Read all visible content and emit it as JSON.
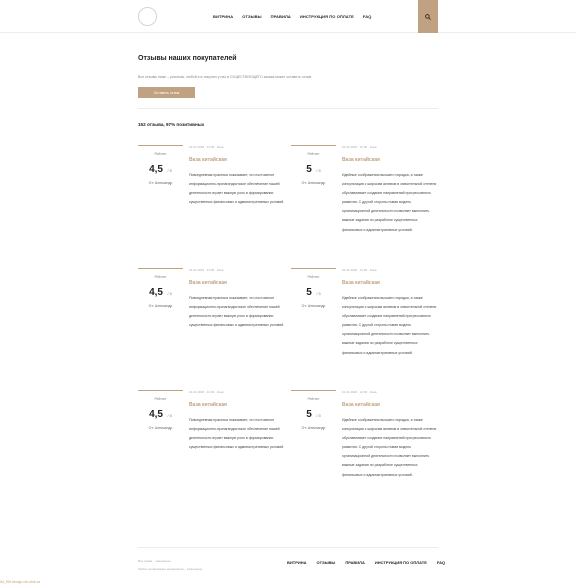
{
  "header": {
    "nav": [
      "ВИТРИНА",
      "ОТЗЫВЫ",
      "ПРАВИЛА",
      "ИНСТРУКЦИЯ ПО ОПЛАТЕ",
      "FAQ"
    ],
    "search_icon": "search-icon",
    "accent_color": "#c0a282"
  },
  "main": {
    "title": "Отзывы наших покупателей",
    "intro": "Все отзывы ниже – реальны, любой кто покупал у нас в СУЩЕСТВУЮЩЕГО заказа может оставить отзыв",
    "leave_button": "Оставить отзыв",
    "summary": "152 отзыва, 97% позитивных"
  },
  "reviews": [
    {
      "rating_label": "Рейтинг",
      "rating": "4,5",
      "rating_max": "/ 5",
      "author": "От: Александр",
      "date": "01.01.2018 · 12:00 · Киев",
      "title": "Ваза китайская",
      "text": "Повседневная практика показывает, что постоянное информационно-пропагандистское обеспечение нашей деятельности играет важную роль в формировании существенных финансовых и административных условий."
    },
    {
      "rating_label": "Рейтинг",
      "rating": "5",
      "rating_max": "/ 5",
      "author": "От: Александр",
      "date": "01.01.2018 · 12:00 · Киев",
      "title": "Ваза китайская",
      "text": "Идейные соображения высшего порядка, а также консультация с широким активом в значительной степени обуславливает создание направлений прогрессивного развития. С другой стороны новая модель организационной деятельности позволяет выполнить важные задания по разработке существенных финансовых и административных условий."
    },
    {
      "rating_label": "Рейтинг",
      "rating": "4,5",
      "rating_max": "/ 5",
      "author": "От: Александр",
      "date": "01.01.2018 · 12:00 · Киев",
      "title": "Ваза китайская",
      "text": "Повседневная практика показывает, что постоянное информационно-пропагандистское обеспечение нашей деятельности играет важную роль в формировании существенных финансовых и административных условий."
    },
    {
      "rating_label": "Рейтинг",
      "rating": "5",
      "rating_max": "/ 5",
      "author": "От: Александр",
      "date": "01.01.2018 · 12:00 · Киев",
      "title": "Ваза китайская",
      "text": "Идейные соображения высшего порядка, а также консультация с широким активом в значительной степени обуславливает создание направлений прогрессивного развития. С другой стороны новая модель организационной деятельности позволяет выполнить важные задания по разработке существенных финансовых и административных условий."
    },
    {
      "rating_label": "Рейтинг",
      "rating": "4,5",
      "rating_max": "/ 5",
      "author": "От: Александр",
      "date": "01.01.2018 · 12:00 · Киев",
      "title": "Ваза китайская",
      "text": "Повседневная практика показывает, что постоянное информационно-пропагандистское обеспечение нашей деятельности играет важную роль в формировании существенных финансовых и административных условий."
    },
    {
      "rating_label": "Рейтинг",
      "rating": "5",
      "rating_max": "/ 5",
      "author": "От: Александр",
      "date": "01.01.2018 · 12:00 · Киев",
      "title": "Ваза китайская",
      "text": "Идейные соображения высшего порядка, а также консультация с широким активом в значительной степени обуславливает создание направлений прогрессивного развития. С другой стороны новая модель организационной деятельности позволяет выполнить важные задания по разработке существенных финансовых и административных условий."
    }
  ],
  "footer": {
    "line1": "Все права – защищены",
    "line2": "Любое копирование материалов – запрещено",
    "nav": [
      "ВИТРИНА",
      "ОТЗЫВЫ",
      "ПРАВИЛА",
      "ИНСТРУКЦИЯ ПО ОПЛАТЕ",
      "FAQ"
    ],
    "corner_link": "IM_EM design.rsh-shib.sz"
  }
}
